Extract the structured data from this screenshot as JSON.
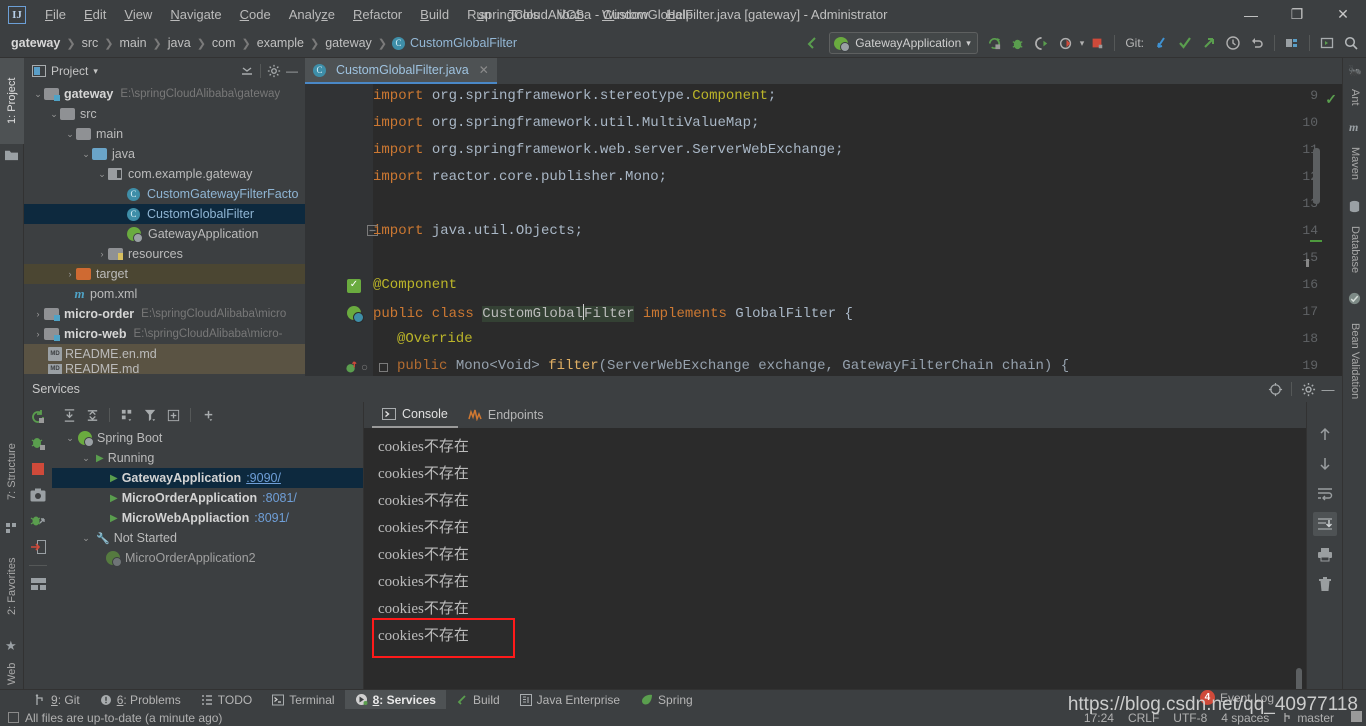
{
  "window": {
    "title": "springCloudAlibaba - CustomGlobalFilter.java [gateway] - Administrator",
    "logo": "IJ",
    "minimize_icon": "—",
    "restore_icon": "❐",
    "close_icon": "✕"
  },
  "menu": [
    {
      "label": "File"
    },
    {
      "label": "Edit"
    },
    {
      "label": "View"
    },
    {
      "label": "Navigate"
    },
    {
      "label": "Code"
    },
    {
      "label": "Analyze"
    },
    {
      "label": "Refactor"
    },
    {
      "label": "Build"
    },
    {
      "label": "Run"
    },
    {
      "label": "Tools"
    },
    {
      "label": "VCS"
    },
    {
      "label": "Window"
    },
    {
      "label": "Help"
    }
  ],
  "breadcrumbs": [
    {
      "label": "gateway",
      "style": "bold"
    },
    {
      "label": "src",
      "style": "plain"
    },
    {
      "label": "main",
      "style": "plain"
    },
    {
      "label": "java",
      "style": "plain"
    },
    {
      "label": "com",
      "style": "plain"
    },
    {
      "label": "example",
      "style": "plain"
    },
    {
      "label": "gateway",
      "style": "plain"
    },
    {
      "label": "CustomGlobalFilter",
      "style": "class"
    }
  ],
  "toolbar": {
    "back_arrow_icon": "back-arrow-icon",
    "run_config": "GatewayApplication",
    "dropdown_caret": "▾",
    "run_icon": "run-icon",
    "debug_icon": "debug-icon",
    "run_coverage_icon": "run-with-coverage-icon",
    "profile_icon": "profiler-icon",
    "stop_icon": "stop-icon",
    "git_label": "Git:",
    "update_project_icon": "update-project-icon",
    "commit_icon": "commit-icon",
    "push_icon": "push-icon",
    "history_icon": "history-icon",
    "rollback_icon": "rollback-icon",
    "project_structure_icon": "project-structure-icon",
    "layout_icon": "layout-icon",
    "search_everywhere_icon": "search-everywhere-icon"
  },
  "left_tool_tabs": [
    {
      "label": "1: Project",
      "icon": "folder-icon",
      "active": true
    },
    {
      "label": "7: Structure",
      "icon": "structure-icon",
      "active": false
    },
    {
      "label": "2: Favorites",
      "icon": "star-icon",
      "active": false
    },
    {
      "label": "Web",
      "icon": "web-icon",
      "active": false
    }
  ],
  "right_tool_tabs": [
    {
      "label": "Ant",
      "icon": "ant-icon"
    },
    {
      "label": "Maven",
      "icon": "maven-icon"
    },
    {
      "label": "Database",
      "icon": "database-icon"
    },
    {
      "label": "Bean Validation",
      "icon": "bean-validation-icon"
    }
  ],
  "project_panel": {
    "title": "Project",
    "caret": "▾",
    "collapse_all_icon": "collapse-all-icon",
    "settings_icon": "gear-icon",
    "hide_icon": "hide-icon",
    "tree": [
      {
        "depth": 0,
        "arrow": "⌄",
        "icon": "module-folder",
        "label": "gateway",
        "bold": true,
        "path": "E:\\springCloudAlibaba\\gateway",
        "state": "normal"
      },
      {
        "depth": 1,
        "arrow": "⌄",
        "icon": "folder",
        "label": "src",
        "bold": false,
        "path": "",
        "state": "normal"
      },
      {
        "depth": 2,
        "arrow": "⌄",
        "icon": "folder",
        "label": "main",
        "bold": false,
        "path": "",
        "state": "normal"
      },
      {
        "depth": 3,
        "arrow": "⌄",
        "icon": "source-folder",
        "label": "java",
        "bold": false,
        "path": "",
        "state": "normal"
      },
      {
        "depth": 4,
        "arrow": "⌄",
        "icon": "package",
        "label": "com.example.gateway",
        "bold": false,
        "path": "",
        "state": "normal"
      },
      {
        "depth": 5,
        "arrow": "",
        "icon": "class",
        "label": "CustomGatewayFilterFactо",
        "bold": false,
        "path": "",
        "state": "normal"
      },
      {
        "depth": 5,
        "arrow": "",
        "icon": "class",
        "label": "CustomGlobalFilter",
        "bold": false,
        "path": "",
        "state": "selected"
      },
      {
        "depth": 5,
        "arrow": "",
        "icon": "spring-class",
        "label": "GatewayApplication",
        "bold": false,
        "path": "",
        "state": "normal"
      },
      {
        "depth": 4,
        "arrow": "›",
        "icon": "resource-folder",
        "label": "resources",
        "bold": false,
        "path": "",
        "state": "normal"
      },
      {
        "depth": 2,
        "arrow": "›",
        "icon": "excluded-folder",
        "label": "target",
        "bold": false,
        "path": "",
        "state": "marked-target"
      },
      {
        "depth": 2,
        "arrow": "",
        "icon": "maven",
        "label": "pom.xml",
        "bold": false,
        "path": "",
        "state": "normal"
      },
      {
        "depth": 0,
        "arrow": "›",
        "icon": "module-folder",
        "label": "micro-order",
        "bold": true,
        "path": "E:\\springCloudAlibaba\\micro",
        "state": "normal"
      },
      {
        "depth": 0,
        "arrow": "›",
        "icon": "module-folder",
        "label": "micro-web",
        "bold": true,
        "path": "E:\\springCloudAlibaba\\micro-",
        "state": "normal"
      },
      {
        "depth": 1,
        "arrow": "",
        "icon": "markdown",
        "label": "README.en.md",
        "bold": false,
        "path": "",
        "state": "marked-readme"
      },
      {
        "depth": 1,
        "arrow": "",
        "icon": "markdown",
        "label": "README.md",
        "bold": false,
        "path": "",
        "state": "marked-readme"
      }
    ]
  },
  "editor": {
    "tab": {
      "label": "CustomGlobalFilter.java",
      "close_icon": "✕",
      "icon": "java-class-icon"
    },
    "lines": [
      {
        "num": 9,
        "segments": [
          {
            "t": "import ",
            "c": "kw"
          },
          {
            "t": "org.springframework.stereotype.",
            "c": "p"
          },
          {
            "t": "Component",
            "c": "ann"
          },
          {
            "t": ";",
            "c": "p"
          }
        ]
      },
      {
        "num": 10,
        "segments": [
          {
            "t": "import ",
            "c": "kw"
          },
          {
            "t": "org.springframework.util.MultiValueMap;",
            "c": "p"
          }
        ]
      },
      {
        "num": 11,
        "segments": [
          {
            "t": "import ",
            "c": "kw"
          },
          {
            "t": "org.springframework.web.server.ServerWebExchange;",
            "c": "p"
          }
        ]
      },
      {
        "num": 12,
        "segments": [
          {
            "t": "import ",
            "c": "kw"
          },
          {
            "t": "reactor.core.publisher.Mono;",
            "c": "p"
          }
        ]
      },
      {
        "num": 13,
        "segments": []
      },
      {
        "num": 14,
        "segments": [
          {
            "t": "import ",
            "c": "kw"
          },
          {
            "t": "java.util.Objects;",
            "c": "p"
          }
        ]
      },
      {
        "num": 15,
        "segments": []
      },
      {
        "num": 16,
        "segments": [
          {
            "t": "    @Component",
            "c": "ann"
          }
        ]
      },
      {
        "num": 17,
        "segments": [
          {
            "t": "    public class ",
            "c": "kw"
          },
          {
            "t": "CustomGlobalFilter",
            "c": "hl"
          },
          {
            "t": " implements ",
            "c": "kw"
          },
          {
            "t": "GlobalFilter",
            "c": "p"
          },
          {
            "t": " {",
            "c": "p"
          }
        ]
      },
      {
        "num": 18,
        "segments": [
          {
            "t": "        @Override",
            "c": "ann"
          }
        ]
      },
      {
        "num": 19,
        "segments": [
          {
            "t": "        public Mono<Void> filter(ServerWebExchange exchange, GatewayFilterChain chain) {",
            "c": "p"
          }
        ]
      }
    ],
    "gutter_icons": {
      "line16": "inspection-ok-icon",
      "line17": "spring-bean-icon",
      "line19": "override-method-icon"
    },
    "marker_ok_icon": "✓"
  },
  "services": {
    "title": "Services",
    "locate_icon": "locate-icon",
    "settings_icon": "gear-icon",
    "hide_icon": "hide-icon",
    "side_icons": [
      {
        "name": "rerun-icon",
        "glyph": "↻"
      },
      {
        "name": "debug-icon",
        "glyph": "🐞"
      },
      {
        "name": "stop-icon",
        "glyph": "■"
      },
      {
        "name": "screenshot-icon",
        "glyph": "▣"
      },
      {
        "name": "attach-debugger-icon",
        "glyph": "🐞"
      },
      {
        "name": "open-console-icon",
        "glyph": "⬅"
      },
      {
        "name": "layout-icon",
        "glyph": "▤"
      }
    ],
    "toolbar_icons": [
      {
        "name": "expand-all-icon",
        "glyph": "⤓"
      },
      {
        "name": "collapse-all-icon",
        "glyph": "⤒"
      },
      {
        "name": "group-by-icon",
        "glyph": "☰"
      },
      {
        "name": "filter-icon",
        "glyph": "▼"
      },
      {
        "name": "add-tab-icon",
        "glyph": "⊞"
      },
      {
        "name": "add-service-icon",
        "glyph": "＋"
      }
    ],
    "tree": [
      {
        "depth": 0,
        "arrow": "⌄",
        "icon": "spring-boot-icon",
        "label": "Spring Boot",
        "bold": false,
        "port": "",
        "state": "normal"
      },
      {
        "depth": 1,
        "arrow": "⌄",
        "icon": "run-icon",
        "label": "Running",
        "bold": false,
        "port": "",
        "state": "normal"
      },
      {
        "depth": 2,
        "arrow": "",
        "icon": "run-icon",
        "label": "GatewayApplication",
        "bold": true,
        "port": ":9090/",
        "state": "selected"
      },
      {
        "depth": 2,
        "arrow": "",
        "icon": "run-icon",
        "label": "MicroOrderApplication",
        "bold": true,
        "port": ":8081/",
        "state": "normal"
      },
      {
        "depth": 2,
        "arrow": "",
        "icon": "run-icon",
        "label": "MicroWebAppliaction",
        "bold": true,
        "port": ":8091/",
        "state": "normal"
      },
      {
        "depth": 1,
        "arrow": "⌄",
        "icon": "wrench-icon",
        "label": "Not Started",
        "bold": false,
        "port": "",
        "state": "normal"
      },
      {
        "depth": 2,
        "arrow": "",
        "icon": "spring-boot-icon",
        "label": "MicroOrderApplication2",
        "bold": false,
        "port": "",
        "state": "normal"
      }
    ],
    "console_tabs": [
      {
        "label": "Console",
        "icon": "console-icon",
        "active": true
      },
      {
        "label": "Endpoints",
        "icon": "endpoints-icon",
        "active": false
      }
    ],
    "console_output": [
      "cookies不存在",
      "cookies不存在",
      "cookies不存在",
      "cookies不存在",
      "cookies不存在",
      "cookies不存在",
      "cookies不存在",
      "cookies不存在"
    ],
    "console_side_icons": [
      {
        "name": "scroll-up-icon",
        "glyph": "↑",
        "active": false
      },
      {
        "name": "scroll-down-icon",
        "glyph": "↓",
        "active": false
      },
      {
        "name": "soft-wrap-icon",
        "glyph": "↵",
        "active": false
      },
      {
        "name": "scroll-to-end-icon",
        "glyph": "⇩",
        "active": true
      },
      {
        "name": "print-icon",
        "glyph": "⎙",
        "active": false
      },
      {
        "name": "clear-all-icon",
        "glyph": "🗑",
        "active": false
      }
    ],
    "highlight_box_color": "#ff1a1a"
  },
  "bottom_tool_tabs": [
    {
      "label": "9: Git",
      "icon": "git-icon",
      "active": false
    },
    {
      "label": "6: Problems",
      "icon": "problems-icon",
      "active": false
    },
    {
      "label": "TODO",
      "icon": "todo-icon",
      "active": false
    },
    {
      "label": "Terminal",
      "icon": "terminal-icon",
      "active": false
    },
    {
      "label": "8: Services",
      "icon": "services-icon",
      "active": true
    },
    {
      "label": "Build",
      "icon": "build-icon",
      "active": false
    },
    {
      "label": "Java Enterprise",
      "icon": "java-enterprise-icon",
      "active": false
    },
    {
      "label": "Spring",
      "icon": "spring-icon",
      "active": false
    }
  ],
  "statusbar": {
    "message": "All files are up-to-date (a minute ago)",
    "message_icon": "file-sync-icon",
    "position": "17:24",
    "line_separator": "CRLF",
    "encoding": "UTF-8",
    "indent": "4 spaces",
    "branch": "master",
    "branch_icon": "branch-icon",
    "lock_icon": "lock-icon"
  },
  "event_log": {
    "label": "Event Log",
    "count": "4"
  },
  "watermark": {
    "text": "https://blog.csdn.net/qq_40977118"
  },
  "colors": {
    "chrome_bg": "#3c3f41",
    "editor_bg": "#2b2b2b",
    "selection_blue": "#0d293e",
    "accent_blue": "#4a88c7",
    "link_blue": "#6f9fd8",
    "green": "#5a9e4e",
    "orange_kw": "#cc7832",
    "yellow_ann": "#bbb529",
    "highlight_red": "#ff1a1a"
  }
}
